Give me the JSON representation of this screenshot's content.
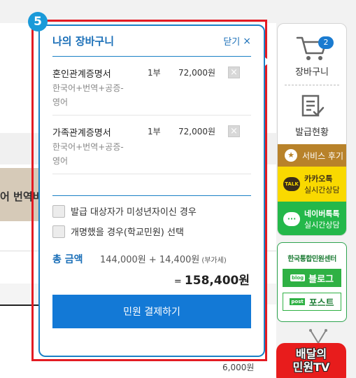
{
  "step_number": "5",
  "background": {
    "partial_text": "어 번역비",
    "price_text": "6,000원"
  },
  "cart": {
    "title": "나의 장바구니",
    "close_label": "닫기",
    "close_icon": "×",
    "items": [
      {
        "name": "혼인관계증명서",
        "desc": "한국어+번역+공증-영어",
        "qty": "1부",
        "price": "72,000원",
        "delete_icon": "×"
      },
      {
        "name": "가족관계증명서",
        "desc": "한국어+번역+공증-영어",
        "qty": "1부",
        "price": "72,000원",
        "delete_icon": "×"
      }
    ],
    "options": [
      {
        "label": "발급 대상자가 미성년자이신 경우",
        "checked": false
      },
      {
        "label": "개명했을 경우(학교민원) 선택",
        "checked": false
      }
    ],
    "total_label": "총 금액",
    "total_calc": "144,000원 + 14,400원",
    "vat_label": "(부가세)",
    "total_eq": "=",
    "total_final": "158,400원",
    "pay_button": "민원 결제하기"
  },
  "quick_menu": {
    "cart_label": "장바구니",
    "cart_count": "2",
    "issue_label": "발급현황",
    "review_label": "서비스 후기",
    "kakao_title": "카카오톡",
    "kakao_sub": "실시간상담",
    "kakao_icon_text": "TALK",
    "naver_title": "네이버톡톡",
    "naver_sub": "실시간상담",
    "naver_icon_text": "···",
    "center_title": "한국통합민원센터",
    "blog_tag": "blog",
    "blog_label": "블로그",
    "post_tag": "post",
    "post_label": "포스트",
    "tv_text": "배달의\n민원TV"
  },
  "colors": {
    "accent_blue": "#1379d6",
    "highlight_red": "#e31b23",
    "kakao_yellow": "#f9d900",
    "naver_green": "#24b84a",
    "review_brown": "#b8822a"
  }
}
